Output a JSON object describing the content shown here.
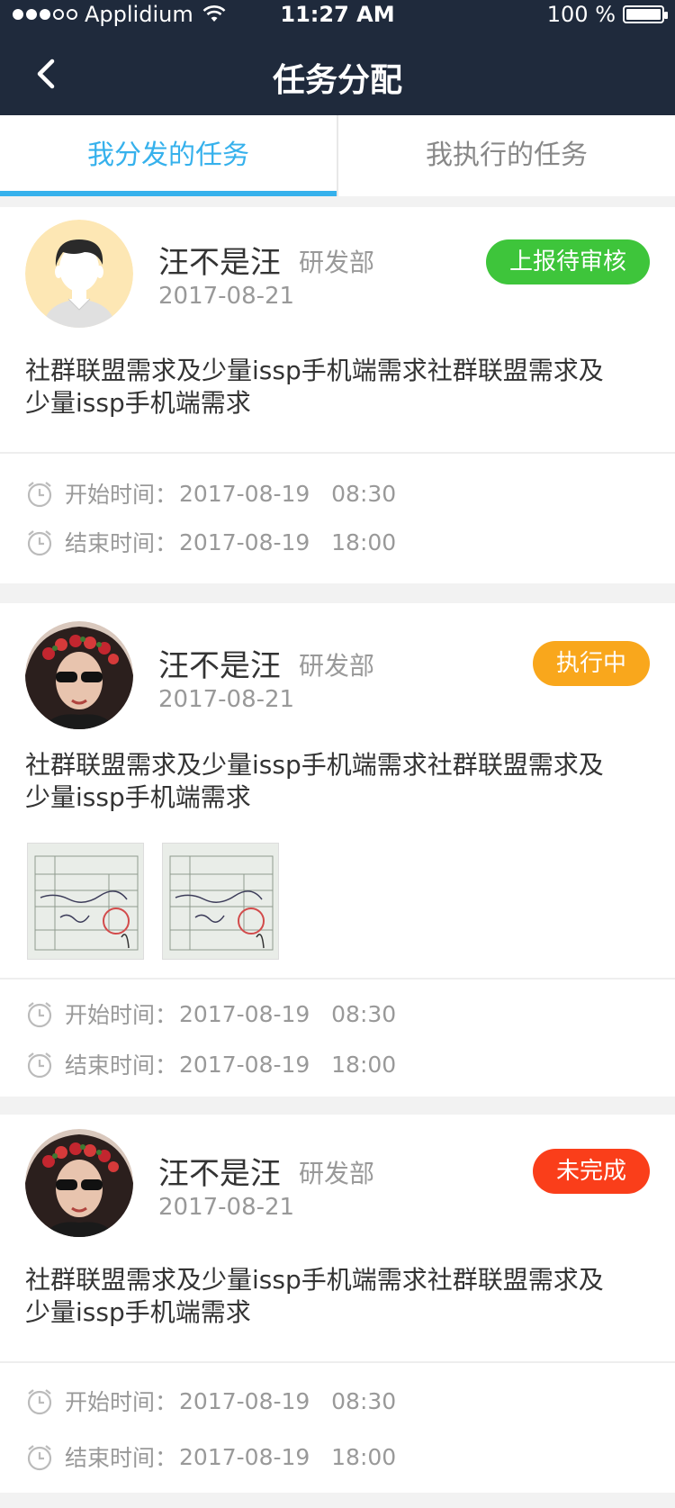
{
  "status_bar": {
    "carrier": "Applidium",
    "time": "11:27 AM",
    "battery": "100 %"
  },
  "nav": {
    "title": "任务分配",
    "back_icon": "chevron-left-icon"
  },
  "tabs": [
    {
      "label": "我分发的任务",
      "active": true
    },
    {
      "label": "我执行的任务",
      "active": false
    }
  ],
  "tasks": [
    {
      "name": "汪不是汪",
      "dept": "研发部",
      "date": "2017-08-21",
      "status": "上报待审核",
      "status_color": "#3ec53b",
      "desc_line1": "社群联盟需求及少量issp手机端需求社群联盟需求及",
      "desc_line2": "少量issp手机端需求",
      "start_label": "开始时间：",
      "start_time": "2017-08-19   08:30",
      "end_label": "结束时间：",
      "end_time": "2017-08-19   18:00"
    },
    {
      "name": "汪不是汪",
      "dept": "研发部",
      "date": "2017-08-21",
      "status": "执行中",
      "status_color": "#f9a71c",
      "desc_line1": "社群联盟需求及少量issp手机端需求社群联盟需求及",
      "desc_line2": "少量issp手机端需求",
      "start_label": "开始时间：",
      "start_time": "2017-08-19   08:30",
      "end_label": "结束时间：",
      "end_time": "2017-08-19   18:00"
    },
    {
      "name": "汪不是汪",
      "dept": "研发部",
      "date": "2017-08-21",
      "status": "未完成",
      "status_color": "#fa3e1a",
      "desc_line1": "社群联盟需求及少量issp手机端需求社群联盟需求及",
      "desc_line2": "少量issp手机端需求",
      "start_label": "开始时间：",
      "start_time": "2017-08-19   08:30",
      "end_label": "结束时间：",
      "end_time": "2017-08-19   18:00"
    }
  ]
}
